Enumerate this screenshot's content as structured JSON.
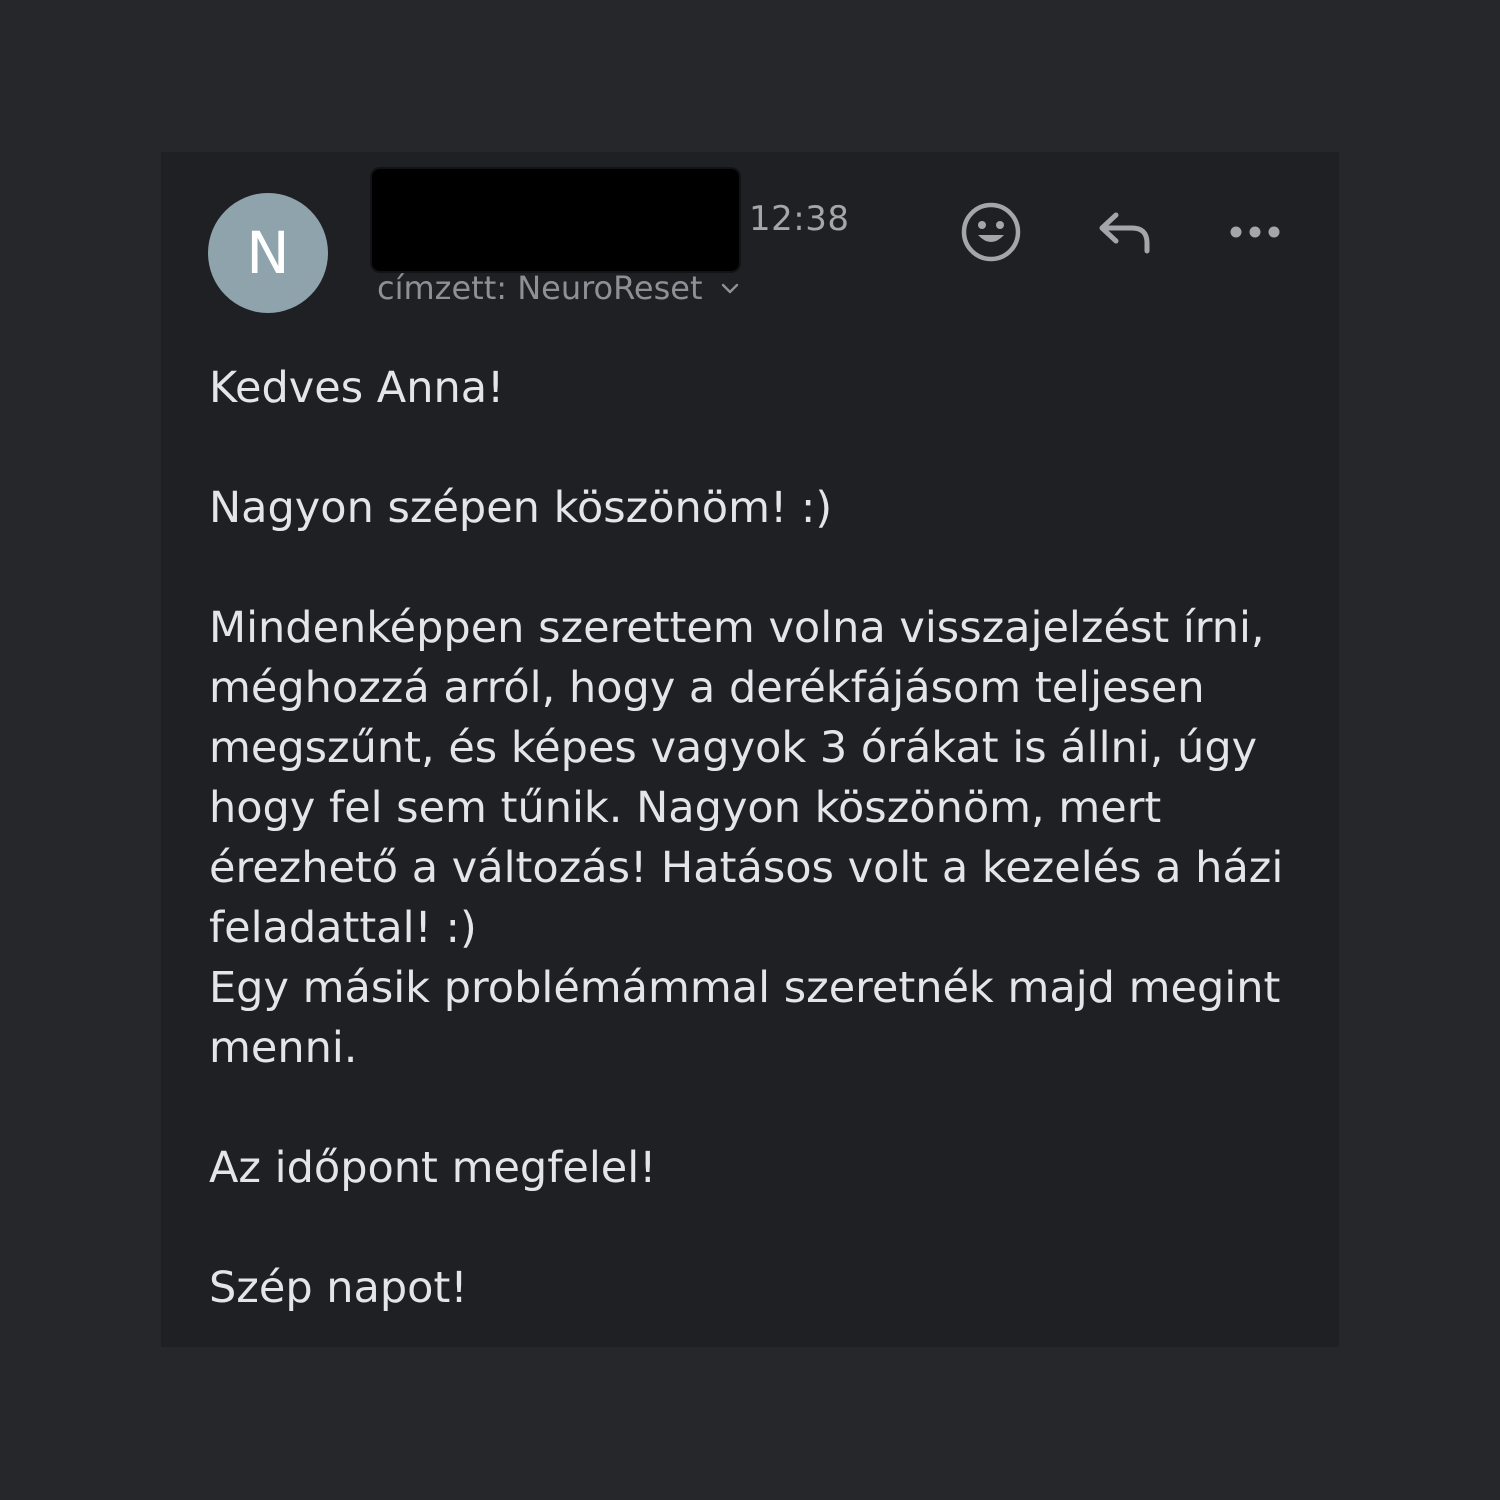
{
  "message": {
    "avatar_initial": "N",
    "time": "12:38",
    "recipient_label": "címzett: NeuroReset",
    "body": {
      "greeting": "Kedves Anna!",
      "thanks": "Nagyon szépen köszönöm! :)",
      "paragraph_1": "Mindenképpen szerettem volna visszajelzést írni, méghozzá arról, hogy a derékfájásom teljesen megszűnt, és képes vagyok 3 órákat is állni, úgy hogy fel sem tűnik. Nagyon köszönöm, mert érezhető a változás! Hatásos volt a kezelés a házi feladattal! :)",
      "paragraph_2": "Egy másik problémámmal szeretnék majd megint menni.",
      "appointment": "Az időpont megfelel!",
      "closing": "Szép napot!"
    }
  },
  "colors": {
    "page_background": "#25272b",
    "card_background": "#1f2024",
    "avatar": "#8fa3ad",
    "text": "#e4e5e7",
    "muted": "#8d9095"
  },
  "icons": {
    "reaction": "smiley-icon",
    "reply": "reply-arrow-icon",
    "more": "more-dots-icon",
    "expand": "chevron-down-icon"
  }
}
